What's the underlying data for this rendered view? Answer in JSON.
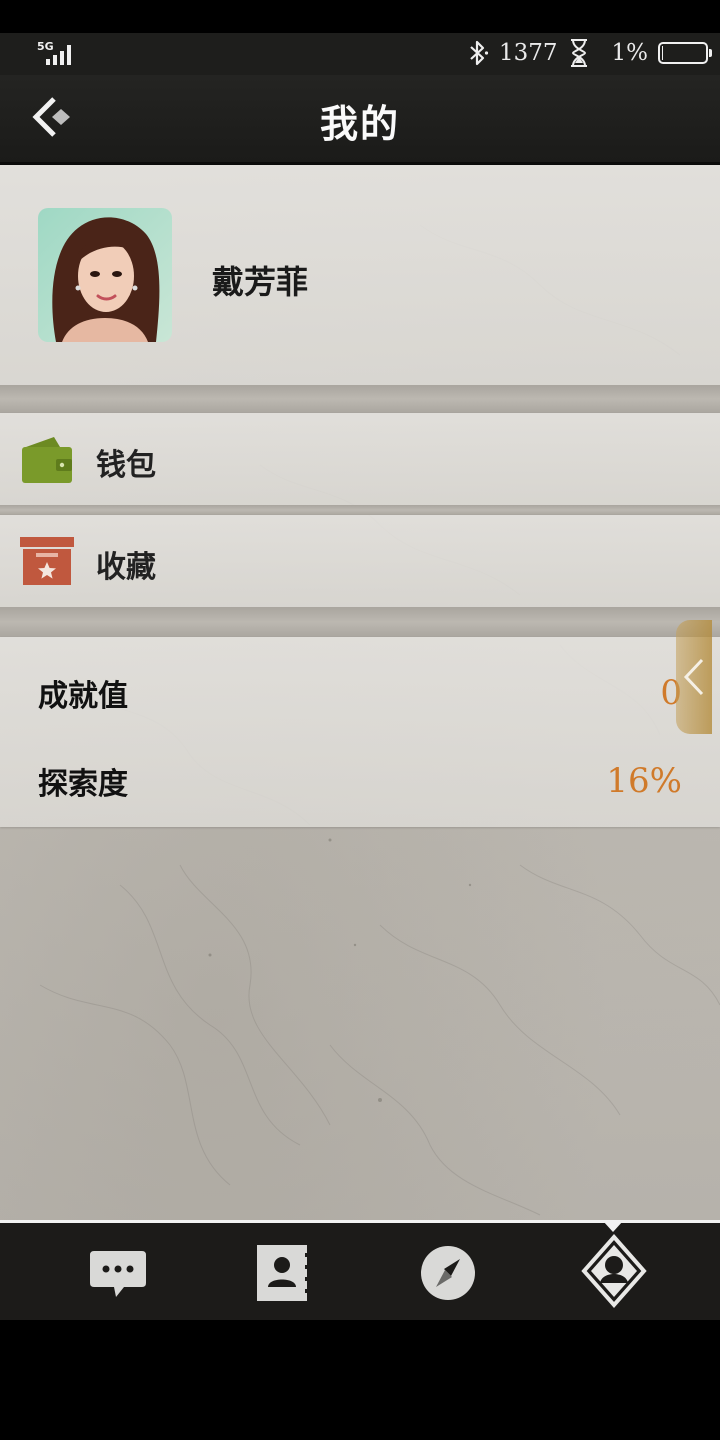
{
  "status_bar": {
    "network": "5G",
    "steps": "1377",
    "battery_percent": "1%",
    "battery_level": 0.01
  },
  "header": {
    "title": "我的"
  },
  "profile": {
    "name": "戴芳菲"
  },
  "menu": {
    "wallet_label": "钱包",
    "favorites_label": "收藏"
  },
  "stats": {
    "achievement_label": "成就值",
    "achievement_value": "0",
    "exploration_label": "探索度",
    "exploration_value": "16%"
  },
  "tabbar": {
    "tabs": [
      "messages",
      "contacts",
      "discover",
      "me"
    ],
    "active_tab": "me"
  },
  "colors": {
    "accent_orange": "#d07a2a",
    "wallet_green": "#7a9a2a",
    "favorites_red": "#c0583e",
    "header_bg": "#1e1e1c"
  }
}
